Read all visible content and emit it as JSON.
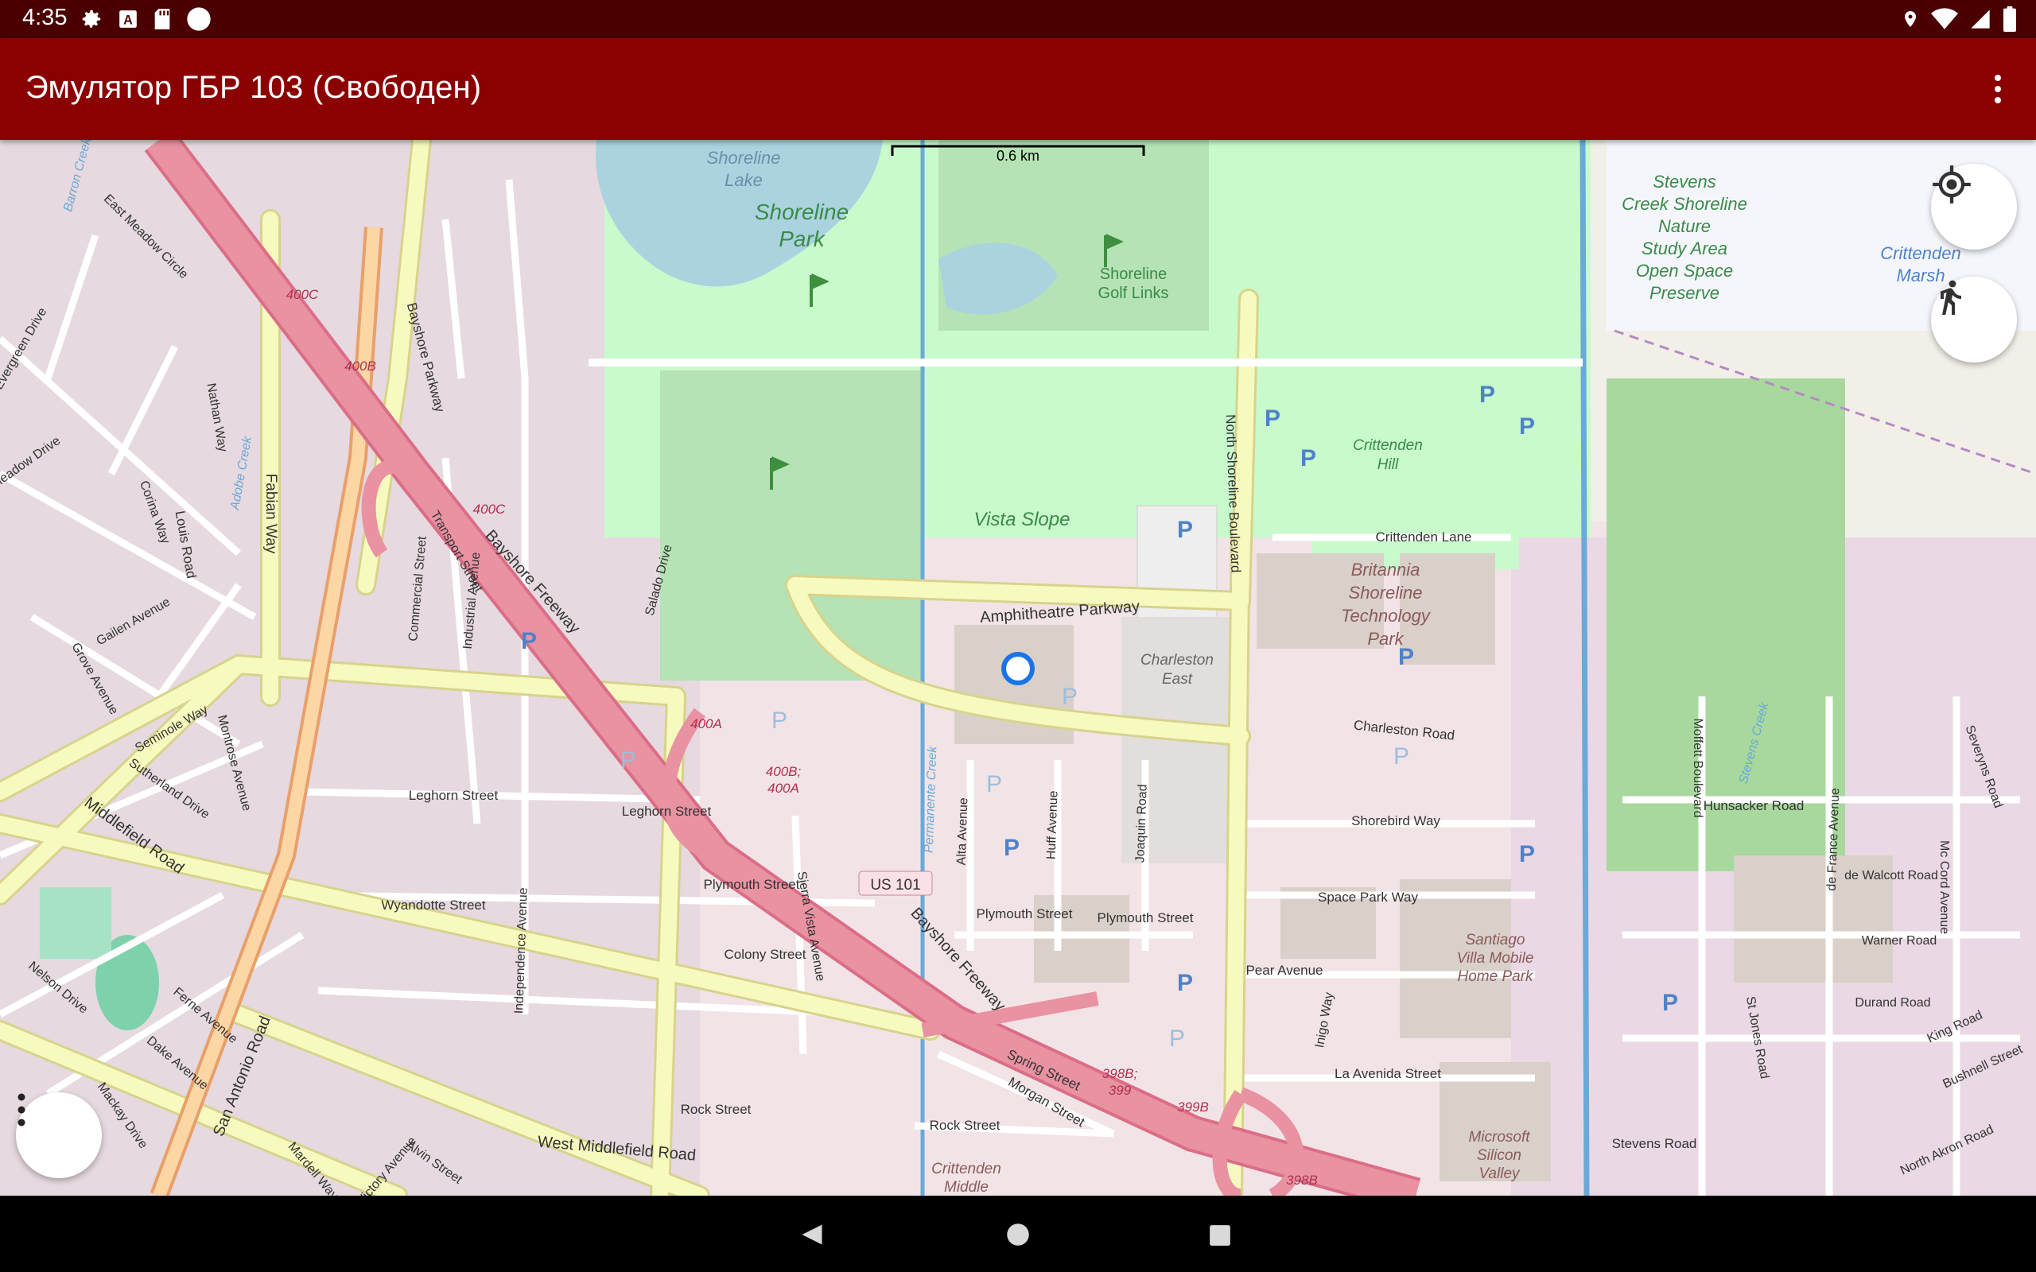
{
  "status_bar": {
    "time": "4:35",
    "left_icons": [
      "gear-icon",
      "a-box-icon",
      "sd-card-icon",
      "circle-icon"
    ],
    "right_icons": [
      "location-pin-icon",
      "wifi-icon",
      "signal-icon",
      "battery-icon"
    ]
  },
  "app_bar": {
    "title": "Эмулятор ГБР 103 (Свободен)",
    "menu_icon": "more-vert-icon"
  },
  "map": {
    "scale_label": "0.6 km",
    "current_location_marker": "blue-ring",
    "labels": {
      "shoreline_lake": "Shoreline\nLake",
      "shoreline_park": "Shoreline\nPark",
      "shoreline_golf": "Shoreline\nGolf Links",
      "stevens_creek": "Stevens\nCreek Shoreline\nNature\nStudy Area\nOpen Space\nPreserve",
      "crittenden_marsh": "Crittenden\nMarsh",
      "crittenden_hill": "Crittenden\nHill",
      "vista_slope": "Vista Slope",
      "crittenden_lane": "Crittenden Lane",
      "britannia": "Britannia\nShoreline\nTechnology\nPark",
      "amphitheatre": "Amphitheatre Parkway",
      "charleston_east": "Charleston\nEast",
      "charleston_road": "Charleston Road",
      "shorebird_way": "Shorebird Way",
      "hunsacker_road": "Hunsacker Road",
      "space_park_way": "Space Park Way",
      "santiago": "Santiago\nVilla Mobile\nHome Park",
      "pear_avenue": "Pear Avenue",
      "la_avenida": "La Avenida Street",
      "microsoft": "Microsoft\nSilicon\nValley",
      "stevens_road": "Stevens Road",
      "crittenden_middle": "Crittenden\nMiddle",
      "bayshore_freeway_1": "Bayshore Freeway",
      "bayshore_freeway_2": "Bayshore Freeway",
      "bayshore_parkway": "Bayshore Parkway",
      "us101": "US 101",
      "fabian_way": "Fabian Way",
      "louis_road": "Louis Road",
      "middlefield_road": "Middlefield Road",
      "west_middlefield": "West Middlefield Road",
      "san_antonio": "San Antonio Road",
      "leghorn_street_1": "Leghorn Street",
      "leghorn_street_2": "Leghorn Street",
      "wyandotte_street": "Wyandotte Street",
      "plymouth_street_1": "Plymouth Street",
      "plymouth_street_2": "Plymouth Street",
      "plymouth_street_3": "Plymouth Street",
      "colony_street": "Colony Street",
      "rock_street_1": "Rock Street",
      "rock_street_2": "Rock Street",
      "spring_street": "Spring Street",
      "morgan_street": "Morgan Street",
      "north_shoreline": "North Shoreline Boulevard",
      "exit_400c_1": "400C",
      "exit_400b_1": "400B",
      "exit_400c_2": "400C",
      "exit_400a": "400A",
      "exit_400b_400a": "400B;\n400A",
      "exit_398b_399": "398B;\n399",
      "exit_399b": "399B",
      "exit_398b": "398B",
      "warner_road": "Warner Road",
      "durand_road": "Durand Road",
      "walcott_road": "Walcott Road",
      "king_road": "King Road",
      "bushnell_street": "Bushnell Street",
      "north_akron": "North Akron Road",
      "moffett_boulevard": "Moffett Boulevard",
      "mc_cord": "Mc Cord Avenue",
      "severyns_road": "Severyns Road",
      "stevens_creek_water": "Stevens Creek",
      "permanente_creek": "Permanente Creek",
      "adobe_creek": "Adobe Creek",
      "barron_creek": "Barron Creek",
      "salado_drive": "Salado Drive",
      "transport_street": "Transport Street",
      "industrial_avenue": "Industrial Avenue",
      "commercial_street": "Commercial Street",
      "nathan_way": "Nathan Way",
      "corina_way": "Corina Way",
      "seminole_way": "Seminole Way",
      "montrose_avenue": "Montrose Avenue",
      "sutherland_drive": "Sutherland Drive",
      "independence_avenue": "Independence Avenue",
      "sierra_vista": "Sierra Vista Avenue",
      "alta_avenue": "Alta Avenue",
      "huff_avenue": "Huff Avenue",
      "joaquin_road": "Joaquin Road",
      "inigo_way": "Inigo Way",
      "ferne_avenue": "Ferne Avenue",
      "dake_avenue": "Dake Avenue",
      "nelson_drive": "Nelson Drive",
      "mackay_drive": "Mackay Drive",
      "victory_avenue": "Victory Avenue",
      "alvin_street": "Alvin Street",
      "mardell_way": "Mardell Way",
      "east_meadow": "East Meadow Circle",
      "grove_avenue": "Grove Avenue",
      "gailen_avenue": "Gailen Avenue",
      "meadow_drive": "Meadow Drive",
      "evergreen_drive": "Evergreen Drive",
      "st_jones_road": "St Jones Road",
      "france_avenue": "de France Avenue"
    }
  },
  "fab": {
    "locate_icon": "gps-fixed-icon",
    "walk_icon": "walking-person-icon",
    "more_icon": "more-vert-icon"
  },
  "nav_bar": {
    "icons": [
      "back-triangle-icon",
      "home-circle-icon",
      "recents-square-icon"
    ]
  },
  "colors": {
    "status_bar": "#4a0000",
    "app_bar": "#8b0000",
    "map_background": "#f2efe9",
    "park_green": "#c8facc",
    "golf_green": "#b5e3b5",
    "water": "#aad3df",
    "motorway": "#e892a2",
    "trunk": "#f9b29c",
    "primary_road": "#f7fabf",
    "location_marker": "#1a73e8"
  }
}
